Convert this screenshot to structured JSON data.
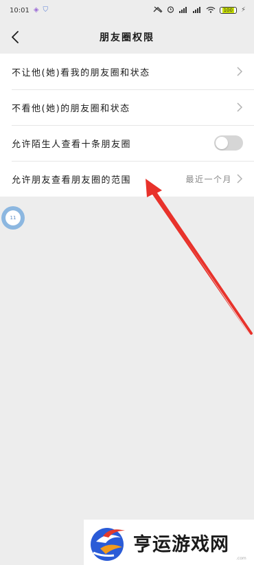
{
  "status_bar": {
    "time": "10:01",
    "signal_label": "HD",
    "battery_label": "100"
  },
  "nav": {
    "title": "朋友圈权限"
  },
  "settings": {
    "items": [
      {
        "label": "不让他(她)看我的朋友圈和状态",
        "type": "link"
      },
      {
        "label": "不看他(她)的朋友圈和状态",
        "type": "link"
      },
      {
        "label": "允许陌生人查看十条朋友圈",
        "type": "toggle",
        "on": false
      },
      {
        "label": "允许朋友查看朋友圈的范围",
        "type": "select",
        "value": "最近一个月"
      }
    ]
  },
  "float_bubble": {
    "text": "11"
  },
  "annotation": {
    "color": "#e8322b"
  },
  "watermark": {
    "text": "亨运游戏网",
    "sub": ".com"
  }
}
